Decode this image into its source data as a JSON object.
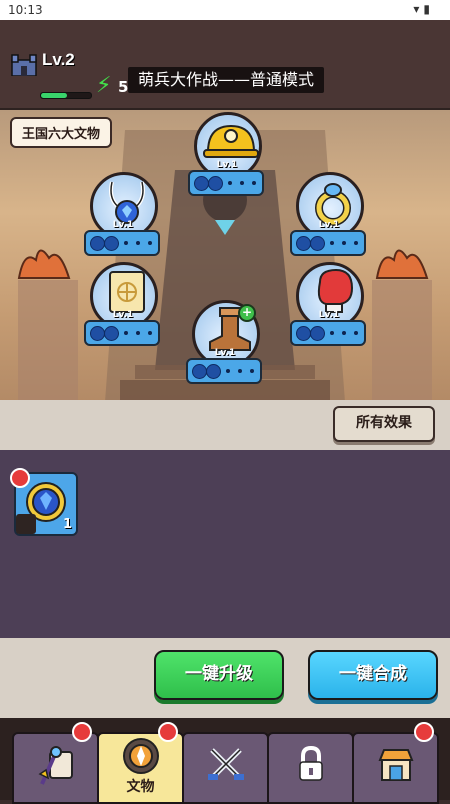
{
  "status_bar": {
    "time": "10:13",
    "icons": [
      "wifi-icon",
      "battery-icon"
    ]
  },
  "header": {
    "level": "Lv.2",
    "xp_fraction": 0.52,
    "energy": "5",
    "mode_banner": "萌兵大作战——普通模式"
  },
  "scene": {
    "section_label": "王国六大文物",
    "relics": [
      {
        "name": "miner-helmet",
        "level": "Lv.1",
        "filled_dots": 2,
        "total_dots": 5
      },
      {
        "name": "horned-gem-pendant",
        "level": "Lv.1",
        "filled_dots": 2,
        "total_dots": 5
      },
      {
        "name": "golden-ring",
        "level": "Lv.1",
        "filled_dots": 2,
        "total_dots": 5
      },
      {
        "name": "ancient-scroll",
        "level": "Lv.1",
        "filled_dots": 2,
        "total_dots": 5
      },
      {
        "name": "leather-boot",
        "level": "Lv.1",
        "filled_dots": 2,
        "total_dots": 5,
        "upgradable": true
      },
      {
        "name": "boxing-glove",
        "level": "Lv.1",
        "filled_dots": 2,
        "total_dots": 5
      }
    ]
  },
  "panel": {
    "all_effects_label": "所有效果"
  },
  "inventory": {
    "items": [
      {
        "name": "sapphire-ring",
        "count": "1",
        "has_alert": true
      }
    ]
  },
  "actions": {
    "upgrade_all": "一键升级",
    "merge_all": "一键合成"
  },
  "nav": {
    "tabs": [
      {
        "name": "heroes",
        "label": "",
        "alert": true
      },
      {
        "name": "relics",
        "label": "文物",
        "alert": true,
        "active": true
      },
      {
        "name": "battle",
        "label": "",
        "alert": false
      },
      {
        "name": "locked",
        "label": "",
        "alert": false
      },
      {
        "name": "shop",
        "label": "",
        "alert": true
      }
    ]
  },
  "colors": {
    "relic_dots_bg": "#4ba7e8",
    "upgrade_green": "#2fbf4b",
    "merge_blue": "#2bb3ea",
    "inventory_bg": "#4d3f56",
    "active_tab": "#f7e79a"
  }
}
